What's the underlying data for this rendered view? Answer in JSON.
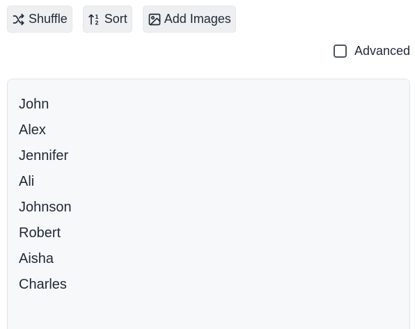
{
  "toolbar": {
    "shuffle": {
      "label": "Shuffle",
      "icon": "shuffle-icon"
    },
    "sort": {
      "label": "Sort",
      "icon": "sort-numeric-icon"
    },
    "add_images": {
      "label": "Add Images",
      "icon": "image-icon"
    }
  },
  "advanced": {
    "label": "Advanced",
    "checked": false
  },
  "names": {
    "items": [
      "John",
      "Alex",
      "Jennifer",
      "Ali",
      "Johnson",
      "Robert",
      "Aisha",
      "Charles"
    ]
  }
}
